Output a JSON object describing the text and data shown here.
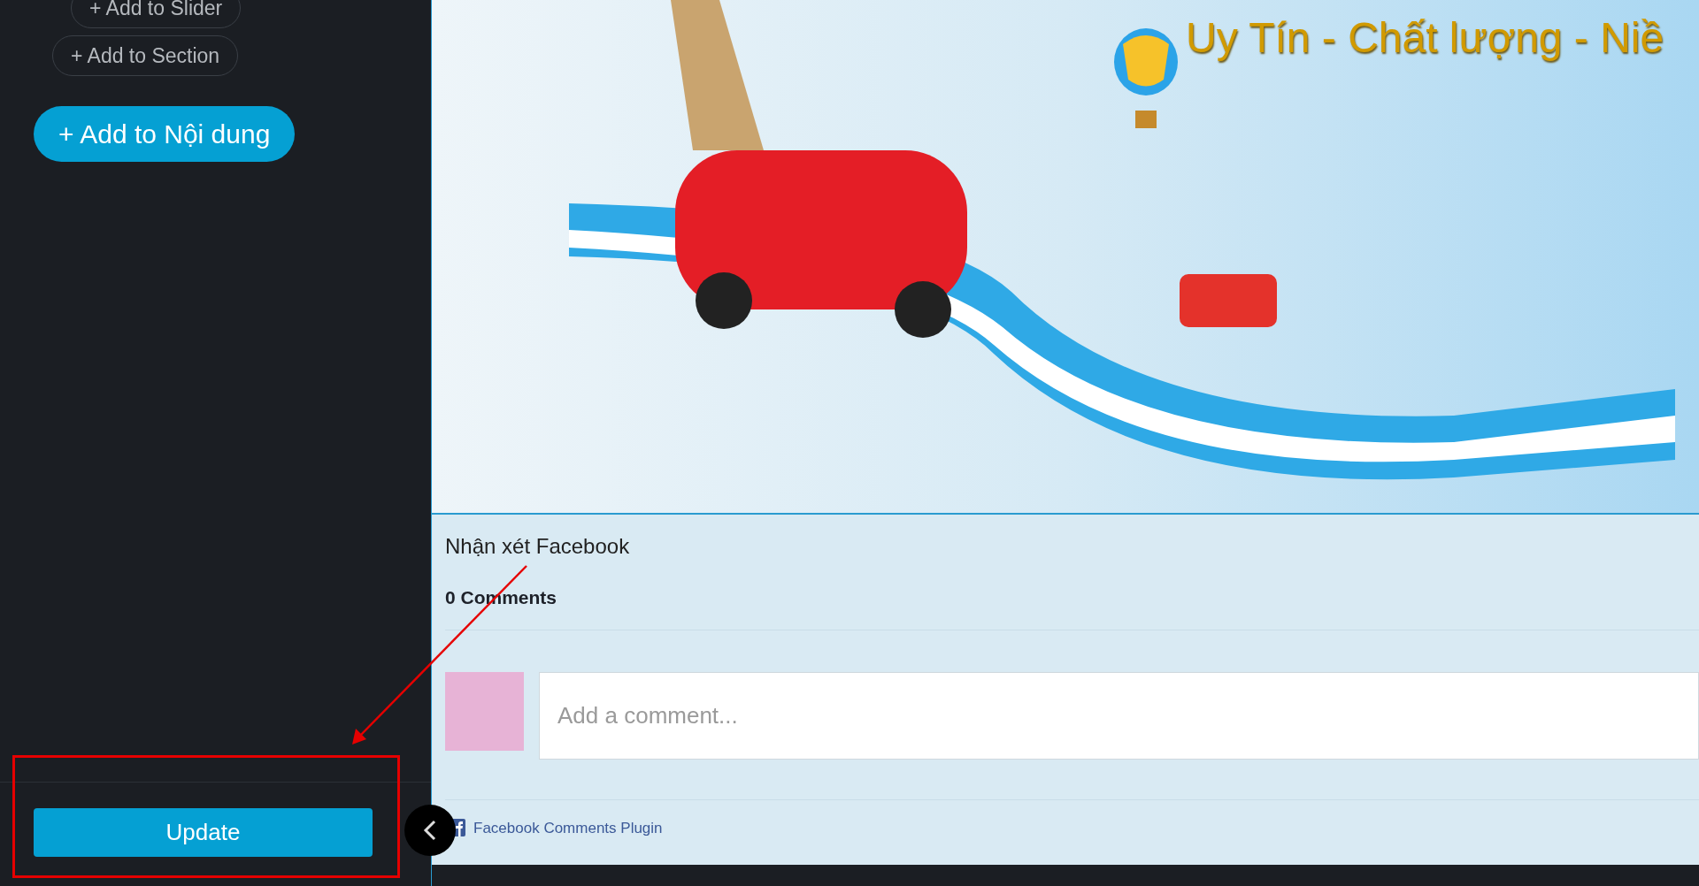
{
  "sidebar": {
    "buttons": [
      {
        "label": "+ Add to Slider",
        "kind": "outline"
      },
      {
        "label": "+ Add to Section",
        "kind": "outline"
      },
      {
        "label": "+ Add to Nội dung",
        "kind": "primary"
      }
    ],
    "update_button": "Update"
  },
  "banner": {
    "headline": "Uy Tín - Chất lượng - Niề"
  },
  "comments": {
    "title": "Nhận xét Facebook",
    "count": "0 Comments",
    "input": {
      "placeholder": "Add a comment..."
    },
    "plugin_link": "Facebook Comments Plugin"
  }
}
